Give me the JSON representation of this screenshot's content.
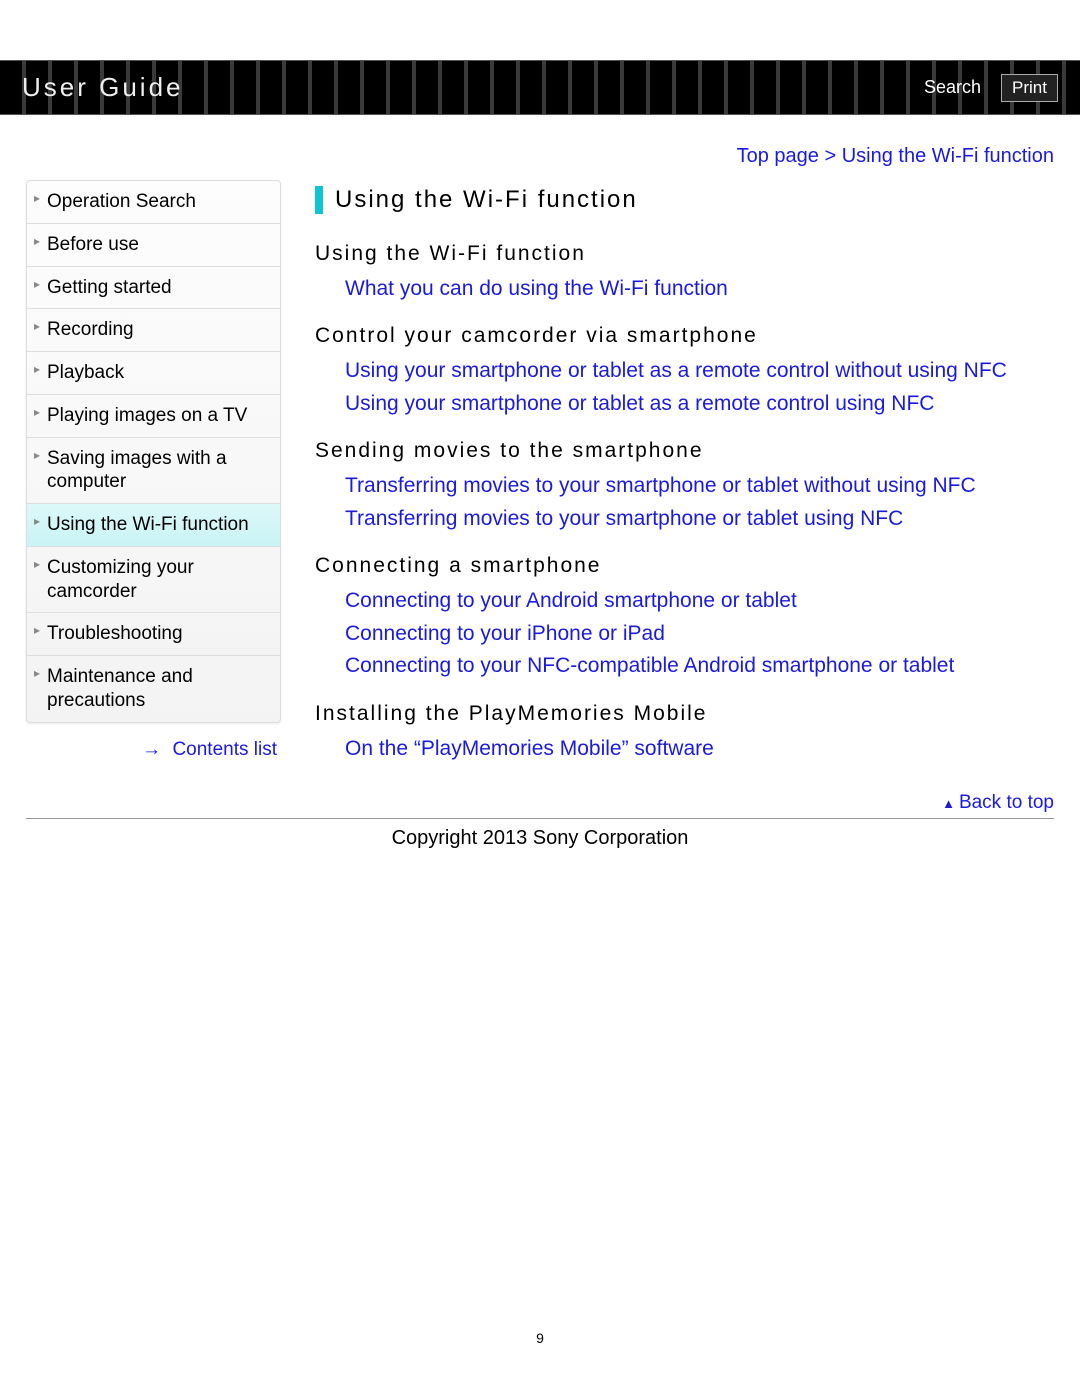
{
  "header": {
    "title": "User Guide",
    "search_label": "Search",
    "print_label": "Print"
  },
  "breadcrumb": {
    "text": "Top page > Using the Wi-Fi function"
  },
  "sidebar": {
    "items": [
      {
        "label": "Operation Search"
      },
      {
        "label": "Before use"
      },
      {
        "label": "Getting started"
      },
      {
        "label": "Recording"
      },
      {
        "label": "Playback"
      },
      {
        "label": "Playing images on a TV"
      },
      {
        "label": "Saving images with a computer"
      },
      {
        "label": "Using the Wi-Fi function",
        "active": true
      },
      {
        "label": "Customizing your camcorder"
      },
      {
        "label": "Troubleshooting"
      },
      {
        "label": "Maintenance and precautions"
      }
    ],
    "contents_list_label": "Contents list"
  },
  "main": {
    "title": "Using the Wi-Fi function",
    "sections": [
      {
        "heading": "Using the Wi-Fi function",
        "links": [
          "What you can do using the Wi-Fi function"
        ]
      },
      {
        "heading": "Control your camcorder via smartphone",
        "links": [
          "Using your smartphone or tablet as a remote control without using NFC",
          "Using your smartphone or tablet as a remote control using NFC"
        ]
      },
      {
        "heading": "Sending movies to the smartphone",
        "links": [
          "Transferring movies to your smartphone or tablet without using NFC",
          "Transferring movies to your smartphone or tablet using NFC"
        ]
      },
      {
        "heading": "Connecting a smartphone",
        "links": [
          "Connecting to your Android smartphone or tablet",
          "Connecting to your iPhone or iPad",
          "Connecting to your NFC-compatible Android smartphone or tablet"
        ]
      },
      {
        "heading": "Installing the PlayMemories Mobile",
        "links": [
          "On the “PlayMemories Mobile” software"
        ]
      }
    ]
  },
  "footer": {
    "back_to_top": "Back to top",
    "copyright": "Copyright 2013 Sony Corporation",
    "page_number": "9"
  }
}
